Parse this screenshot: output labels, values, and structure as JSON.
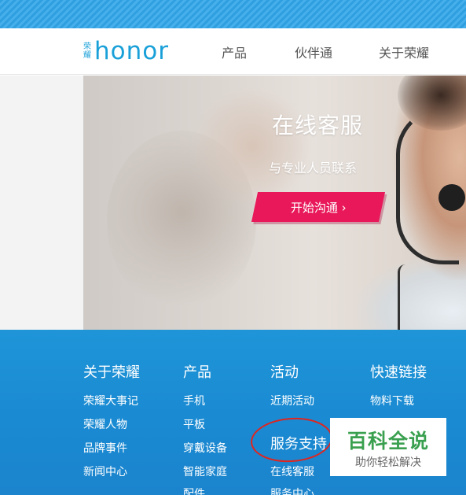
{
  "header": {
    "logo_mark": "荣耀",
    "logo_text": "honor",
    "nav": [
      "产品",
      "伙伴通",
      "关于荣耀"
    ]
  },
  "hero": {
    "title": "在线客服",
    "subtitle": "与专业人员联系",
    "button_label": "开始沟通 ›"
  },
  "footer": {
    "columns": [
      {
        "title": "关于荣耀",
        "links": [
          "荣耀大事记",
          "荣耀人物",
          "品牌事件",
          "新闻中心"
        ]
      },
      {
        "title": "产品",
        "links": [
          "手机",
          "平板",
          "穿戴设备",
          "智能家庭",
          "配件"
        ]
      },
      {
        "title": "活动",
        "links": [
          "近期活动",
          "服务支持",
          "在线客服",
          "服务中心"
        ]
      },
      {
        "title": "快速链接",
        "links": [
          "物料下载"
        ]
      }
    ]
  },
  "watermark": {
    "title": "百科全说",
    "subtitle": "助你轻松解决"
  },
  "colors": {
    "brand": "#19a0d8",
    "footer_blue": "#1a8ad2",
    "cta_pink": "#e8185a",
    "annotation_red": "#e0251f",
    "watermark_green": "#3aa04f"
  }
}
